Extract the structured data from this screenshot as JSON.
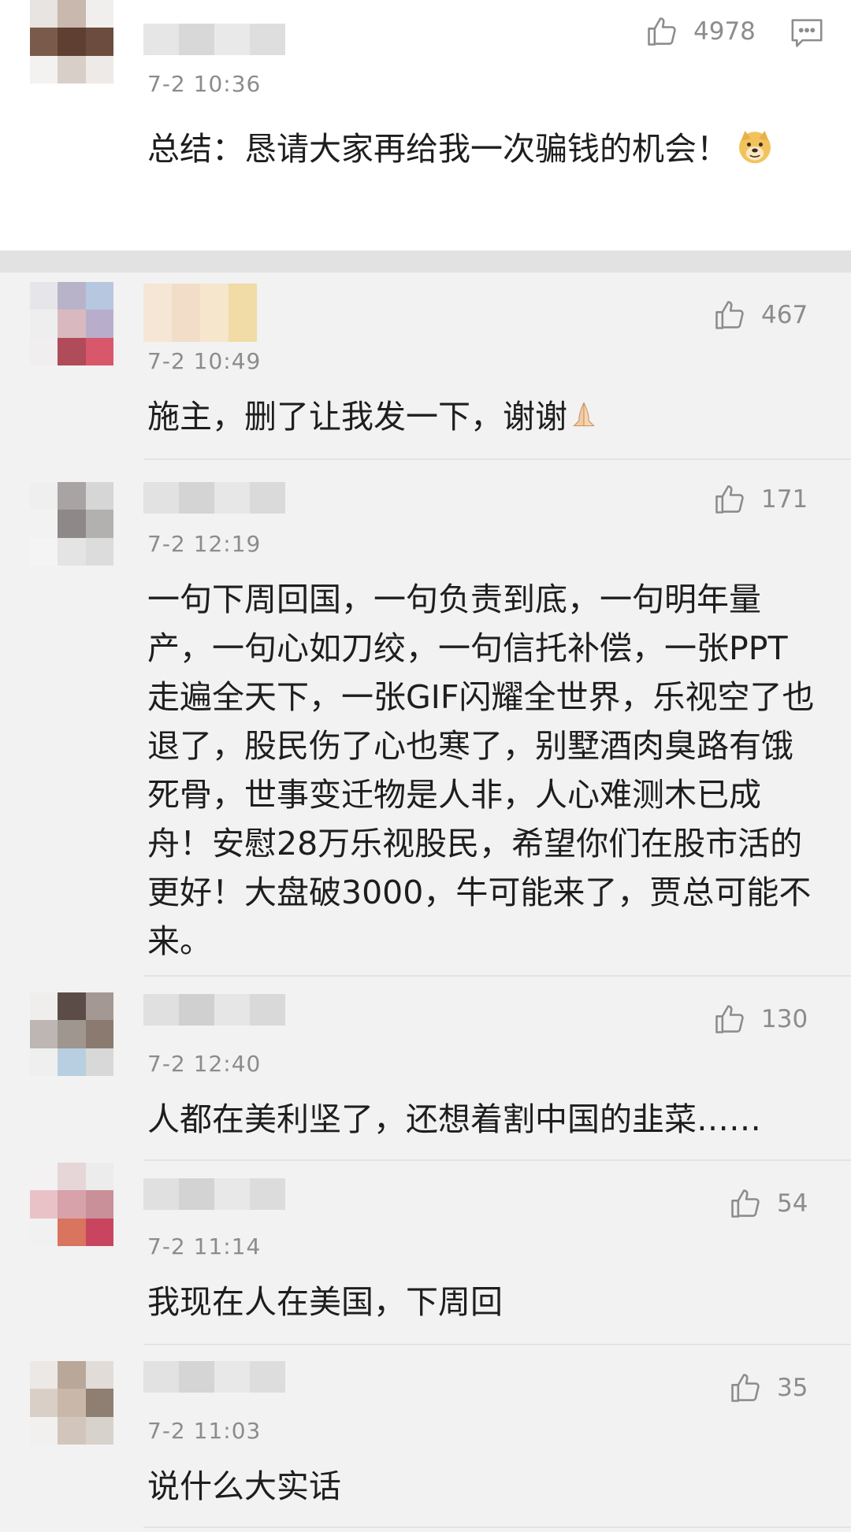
{
  "comments": [
    {
      "time": "7-2 10:36",
      "likes": "4978",
      "text": "总结：恳请大家再给我一次骗钱的机会！",
      "emoji": "doge-icon"
    },
    {
      "time": "7-2 10:49",
      "likes": "467",
      "text": "施主，删了让我发一下，谢谢",
      "emoji": "pray-icon"
    },
    {
      "time": "7-2 12:19",
      "likes": "171",
      "text": "一句下周回国，一句负责到底，一句明年量产，一句心如刀绞，一句信托补偿，一张PPT走遍全天下，一张GIF闪耀全世界，乐视空了也退了，股民伤了心也寒了，别墅酒肉臭路有饿死骨，世事变迁物是人非，人心难测木已成舟！安慰28万乐视股民，希望你们在股市活的更好！大盘破3000，牛可能来了，贾总可能不来。"
    },
    {
      "time": "7-2 12:40",
      "likes": "130",
      "text": "人都在美利坚了，还想着割中国的韭菜……"
    },
    {
      "time": "7-2 11:14",
      "likes": "54",
      "text": "我现在人在美国，下周回"
    },
    {
      "time": "7-2 11:03",
      "likes": "35",
      "text": "说什么大实话"
    }
  ],
  "icons": {
    "like": "thumbs-up-icon",
    "reply": "comment-icon"
  },
  "colors": {
    "background": "#f2f2f2",
    "card": "#ffffff",
    "meta": "#8c8c8c",
    "text": "#1e1e1e"
  }
}
